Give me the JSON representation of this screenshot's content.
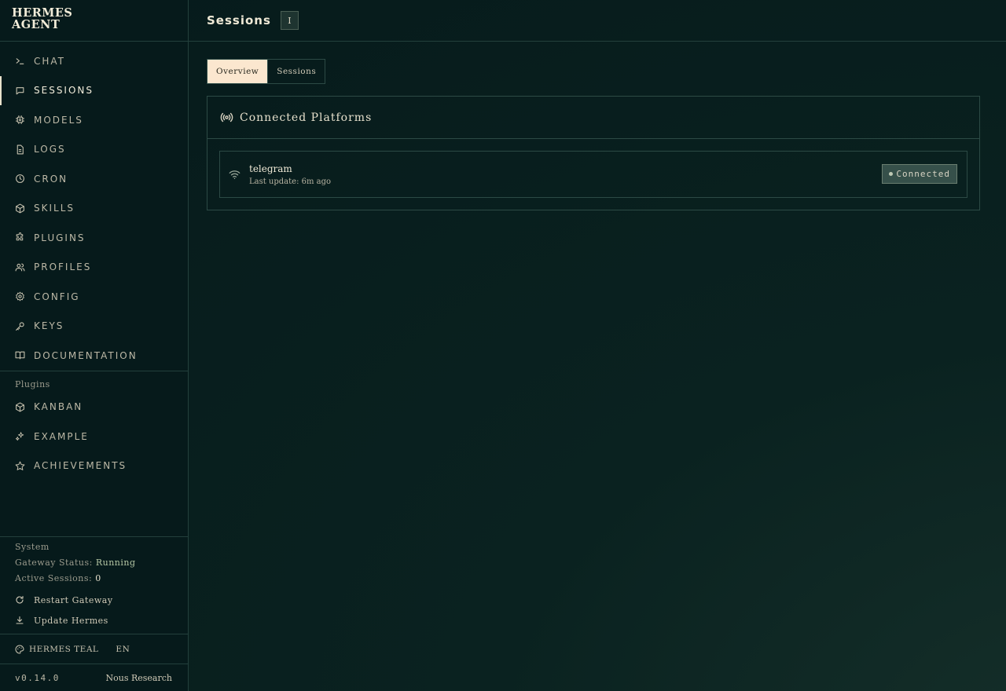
{
  "brand": {
    "line1": "HERMES",
    "line2": "AGENT"
  },
  "nav": [
    {
      "label": "CHAT",
      "icon": "terminal-icon",
      "active": false
    },
    {
      "label": "SESSIONS",
      "icon": "chat-bubble-icon",
      "active": true
    },
    {
      "label": "MODELS",
      "icon": "chip-icon",
      "active": false
    },
    {
      "label": "LOGS",
      "icon": "file-text-icon",
      "active": false
    },
    {
      "label": "CRON",
      "icon": "clock-icon",
      "active": false
    },
    {
      "label": "SKILLS",
      "icon": "package-icon",
      "active": false
    },
    {
      "label": "PLUGINS",
      "icon": "puzzle-icon",
      "active": false
    },
    {
      "label": "PROFILES",
      "icon": "users-icon",
      "active": false
    },
    {
      "label": "CONFIG",
      "icon": "gear-icon",
      "active": false
    },
    {
      "label": "KEYS",
      "icon": "key-icon",
      "active": false
    },
    {
      "label": "DOCUMENTATION",
      "icon": "book-icon",
      "active": false
    }
  ],
  "plugins_section": {
    "label": "Plugins",
    "items": [
      {
        "label": "KANBAN",
        "icon": "package-icon"
      },
      {
        "label": "EXAMPLE",
        "icon": "sparkles-icon"
      },
      {
        "label": "ACHIEVEMENTS",
        "icon": "star-icon"
      }
    ]
  },
  "system": {
    "label": "System",
    "gateway_label": "Gateway Status:",
    "gateway_value": "Running",
    "sessions_label": "Active Sessions:",
    "sessions_value": "0",
    "restart_label": "Restart Gateway",
    "update_label": "Update Hermes"
  },
  "theme": {
    "name": "HERMES TEAL",
    "lang": "EN"
  },
  "footer": {
    "version": "v0.14.0",
    "org": "Nous Research"
  },
  "header": {
    "title": "Sessions",
    "badge": "I"
  },
  "tabs": [
    {
      "label": "Overview",
      "active": true
    },
    {
      "label": "Sessions",
      "active": false
    }
  ],
  "panel": {
    "title": "Connected Platforms",
    "platforms": [
      {
        "name": "telegram",
        "update": "Last update: 6m ago",
        "status": "Connected"
      }
    ]
  },
  "colors": {
    "accent_tab": "#fbe7cf",
    "background": "#061a1b",
    "running": "#b4c6a4"
  }
}
